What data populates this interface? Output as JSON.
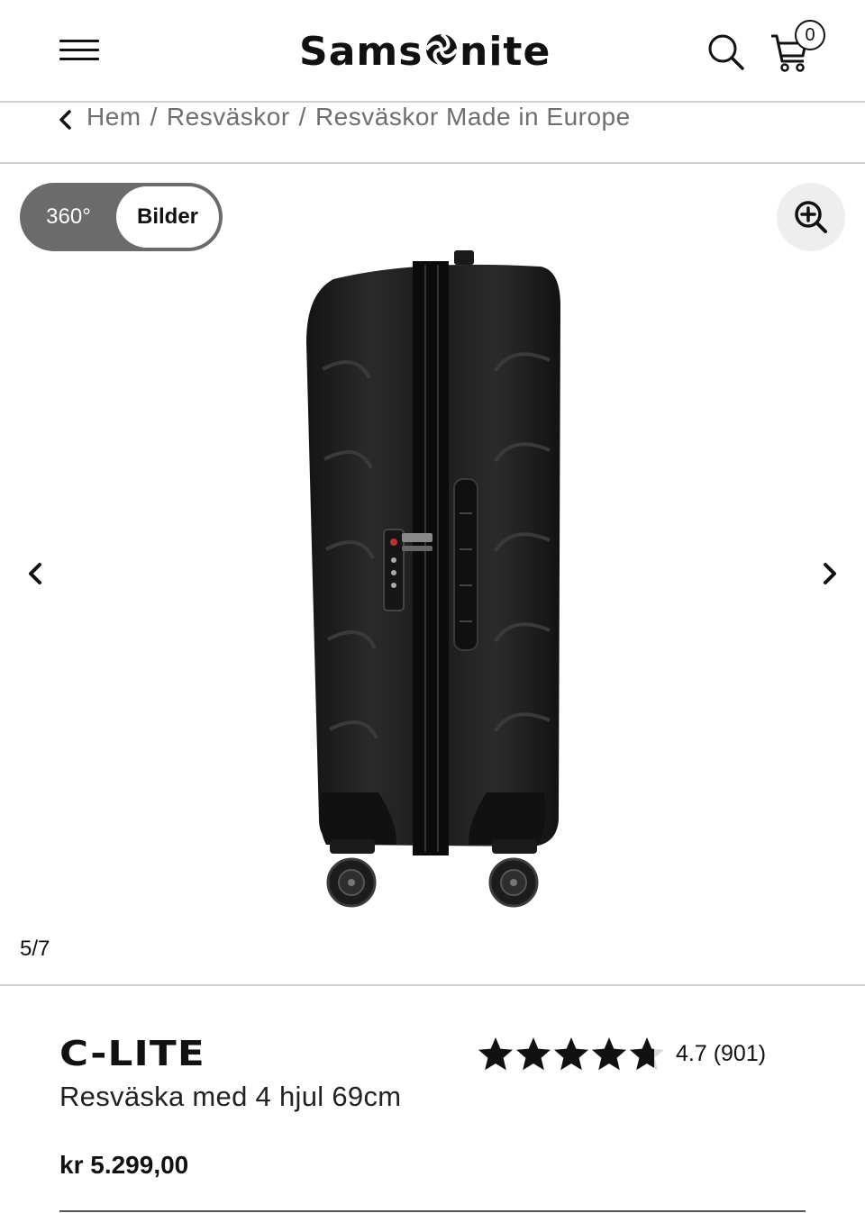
{
  "header": {
    "brand": "Samsonite",
    "cart_count": "0"
  },
  "breadcrumb": {
    "items": [
      "Hem",
      "Resväskor",
      "Resväskor Made in Europe"
    ],
    "separator": "/"
  },
  "gallery": {
    "toggle_360_label": "360°",
    "toggle_images_label": "Bilder",
    "active_view": "Bilder",
    "counter": "5/7",
    "current_image": 5,
    "total_images": 7
  },
  "product": {
    "name": "C-LITE",
    "subtitle": "Resväska med 4 hjul 69cm",
    "price": "kr 5.299,00",
    "rating_value": 4.7,
    "rating_text": "4.7 (901)",
    "rating_max": 5
  },
  "icons": {
    "menu": "hamburger-icon",
    "search": "search-icon",
    "cart": "cart-icon",
    "back": "chevron-left-icon",
    "zoom": "zoom-in-icon",
    "prev": "chevron-left-icon",
    "next": "chevron-right-icon",
    "star": "star-icon"
  },
  "colors": {
    "toggle_bg": "#6b6b6b",
    "zoom_bg": "#eeeeee",
    "breadcrumb_text": "#6f6f6f",
    "divider": "#cfcfcf"
  }
}
